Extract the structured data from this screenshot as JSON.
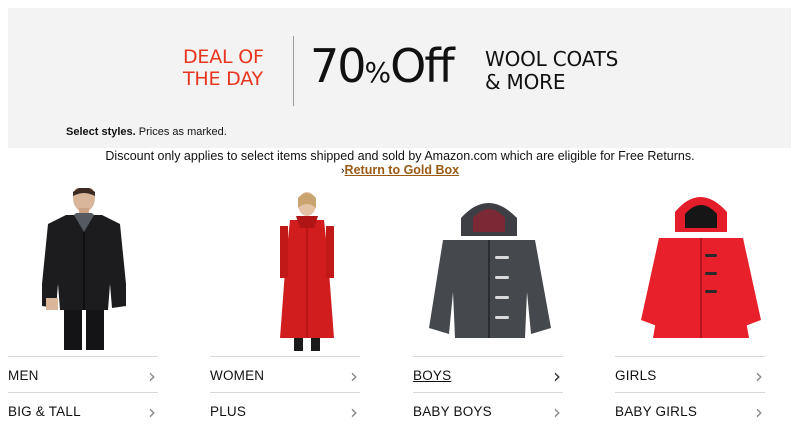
{
  "banner": {
    "deal_line1": "DEAL OF",
    "deal_line2": "THE DAY",
    "percent_number": "70",
    "percent_symbol": "%",
    "percent_word": "Off",
    "product_line1": "WOOL COATS",
    "product_line2": "& MORE",
    "styles_bold": "Select styles.",
    "styles_rest": " Prices as marked.",
    "accent_color": "#e8351f"
  },
  "disclaimer": "Discount only applies to select items shipped and sold by Amazon.com which are eligible for Free Returns.",
  "return_link": {
    "arrow": "›",
    "label": "Return to Gold Box",
    "color": "#9a5a14"
  },
  "categories": [
    {
      "image_icon": "mens-black-coat-image",
      "links": [
        {
          "label": "MEN",
          "chevron": "›"
        },
        {
          "label": "BIG & TALL",
          "chevron": "›"
        }
      ]
    },
    {
      "image_icon": "womens-red-coat-image",
      "links": [
        {
          "label": "WOMEN",
          "chevron": "›"
        },
        {
          "label": "PLUS",
          "chevron": "›"
        }
      ]
    },
    {
      "image_icon": "boys-gray-hooded-coat-image",
      "links": [
        {
          "label": "BOYS",
          "chevron": "›",
          "hovered": true
        },
        {
          "label": "BABY BOYS",
          "chevron": "›"
        }
      ]
    },
    {
      "image_icon": "girls-red-hooded-coat-image",
      "links": [
        {
          "label": "GIRLS",
          "chevron": "›"
        },
        {
          "label": "BABY GIRLS",
          "chevron": "›"
        }
      ]
    }
  ]
}
